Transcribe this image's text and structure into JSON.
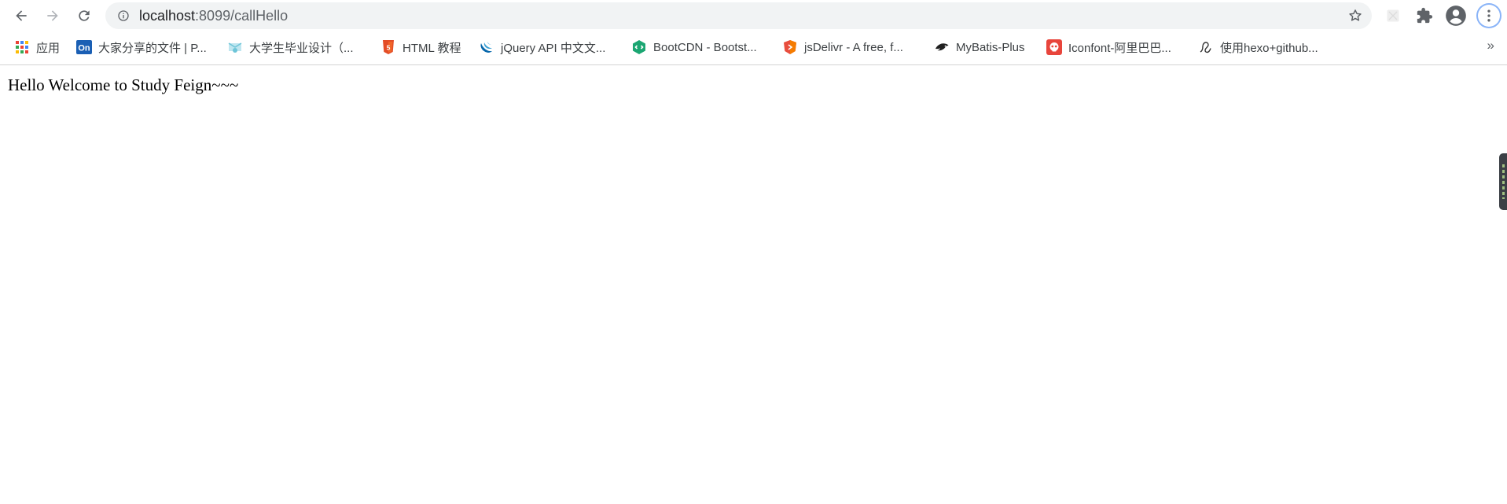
{
  "browser": {
    "url_host": "localhost",
    "url_path": ":8099/callHello"
  },
  "icons": {
    "back": "back-arrow-icon",
    "forward": "forward-arrow-icon",
    "reload": "reload-icon",
    "site_info": "info-icon",
    "bookmark_star": "star-icon",
    "extension": "extension-icon",
    "puzzle": "puzzle-icon",
    "profile": "account-icon",
    "menu": "kebab-menu-icon"
  },
  "bookmarks": [
    {
      "label": "应用",
      "icon": "apps-grid-icon"
    },
    {
      "label": "大家分享的文件 | P...",
      "icon": "on-icon"
    },
    {
      "label": "大学生毕业设计（...",
      "icon": "graduation-icon"
    },
    {
      "label": "HTML 教程",
      "icon": "html-icon"
    },
    {
      "label": "jQuery API 中文文...",
      "icon": "jquery-icon"
    },
    {
      "label": "BootCDN - Bootst...",
      "icon": "bootcdn-icon"
    },
    {
      "label": "jsDelivr - A free, f...",
      "icon": "jsdelivr-icon"
    },
    {
      "label": "MyBatis-Plus",
      "icon": "mybatis-bird-icon"
    },
    {
      "label": "Iconfont-阿里巴巴...",
      "icon": "iconfont-icon"
    },
    {
      "label": "使用hexo+github...",
      "icon": "hexo-icon"
    }
  ],
  "bookmarks_overflow": "»",
  "page": {
    "text": "Hello Welcome to Study Feign~~~"
  },
  "colors": {
    "omnibox_bg": "#f1f3f4",
    "profile_ring": "#8ab4f8"
  }
}
